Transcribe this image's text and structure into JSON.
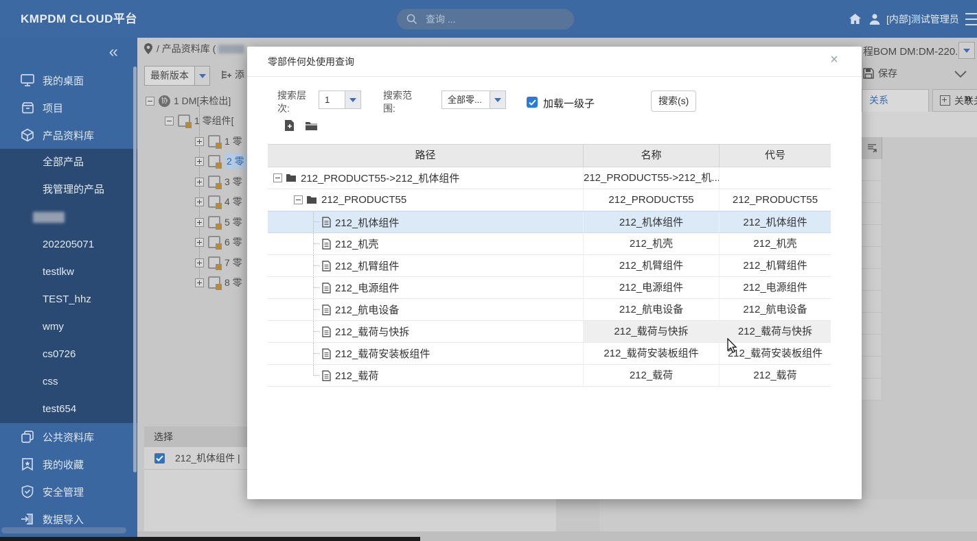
{
  "topbar": {
    "logo": "KMPDM CLOUD平台",
    "search_placeholder": "查询 ...",
    "username": "[内部]测试管理员"
  },
  "sidebar": {
    "collapse_icon": "«",
    "main_items": [
      {
        "label": "我的桌面"
      },
      {
        "label": "项目"
      },
      {
        "label": "产品资料库"
      }
    ],
    "sub_items": [
      {
        "label": "全部产品"
      },
      {
        "label": "我管理的产品"
      },
      {
        "label": "",
        "redacted": true
      },
      {
        "label": "202205071"
      },
      {
        "label": "testlkw"
      },
      {
        "label": "TEST_hhz"
      },
      {
        "label": "wmy"
      },
      {
        "label": "cs0726"
      },
      {
        "label": "css"
      },
      {
        "label": "test654"
      }
    ],
    "bottom_items": [
      {
        "label": "公共资料库"
      },
      {
        "label": "我的收藏"
      },
      {
        "label": "安全管理"
      },
      {
        "label": "数据导入"
      }
    ]
  },
  "workspace": {
    "breadcrumb": "/ 产品资料库 (",
    "version_dropdown": "最新版本",
    "toolbar_partial": "添",
    "tree": [
      {
        "label": "1 DM[未检出]",
        "badge": "协"
      },
      {
        "label": "1 零组件["
      },
      {
        "label": "1 零"
      },
      {
        "label": "2 零"
      },
      {
        "label": "3 零"
      },
      {
        "label": "4 零"
      },
      {
        "label": "5 零"
      },
      {
        "label": "6 零"
      },
      {
        "label": "7 零"
      },
      {
        "label": "8 零"
      }
    ],
    "select_table": {
      "header": "选择",
      "row_label": "212_机体组件 |"
    },
    "right_panel": {
      "bom_selector": "程BOM DM:DM-220...",
      "save_label": "保存",
      "tab_active": "关系",
      "tab_secondary": "关联关系",
      "tabs_more": "»"
    }
  },
  "modal": {
    "title": "零部件何处使用查询",
    "close_label": "×",
    "controls": {
      "search_level_label": "搜索层次:",
      "search_level_value": "1",
      "search_scope_label": "搜索范围:",
      "search_scope_value": "全部零...",
      "load_children_label": "加载一级子",
      "search_button_label": "搜索(s)"
    },
    "table": {
      "columns": [
        "路径",
        "名称",
        "代号"
      ],
      "rows": [
        {
          "path": "212_PRODUCT55->212_机体组件",
          "name": "212_PRODUCT55->212_机...",
          "code": ""
        },
        {
          "path": "212_PRODUCT55",
          "name": "212_PRODUCT55",
          "code": "212_PRODUCT55"
        },
        {
          "path": "212_机体组件",
          "name": "212_机体组件",
          "code": "212_机体组件"
        },
        {
          "path": "212_机壳",
          "name": "212_机壳",
          "code": "212_机壳"
        },
        {
          "path": "212_机臂组件",
          "name": "212_机臂组件",
          "code": "212_机臂组件"
        },
        {
          "path": "212_电源组件",
          "name": "212_电源组件",
          "code": "212_电源组件"
        },
        {
          "path": "212_航电设备",
          "name": "212_航电设备",
          "code": "212_航电设备"
        },
        {
          "path": "212_载荷与快拆",
          "name": "212_载荷与快拆",
          "code": "212_载荷与快拆"
        },
        {
          "path": "212_载荷安装板组件",
          "name": "212_载荷安装板组件",
          "code": "212_载荷安装板组件"
        },
        {
          "path": "212_载荷",
          "name": "212_载荷",
          "code": "212_载荷"
        }
      ]
    }
  }
}
